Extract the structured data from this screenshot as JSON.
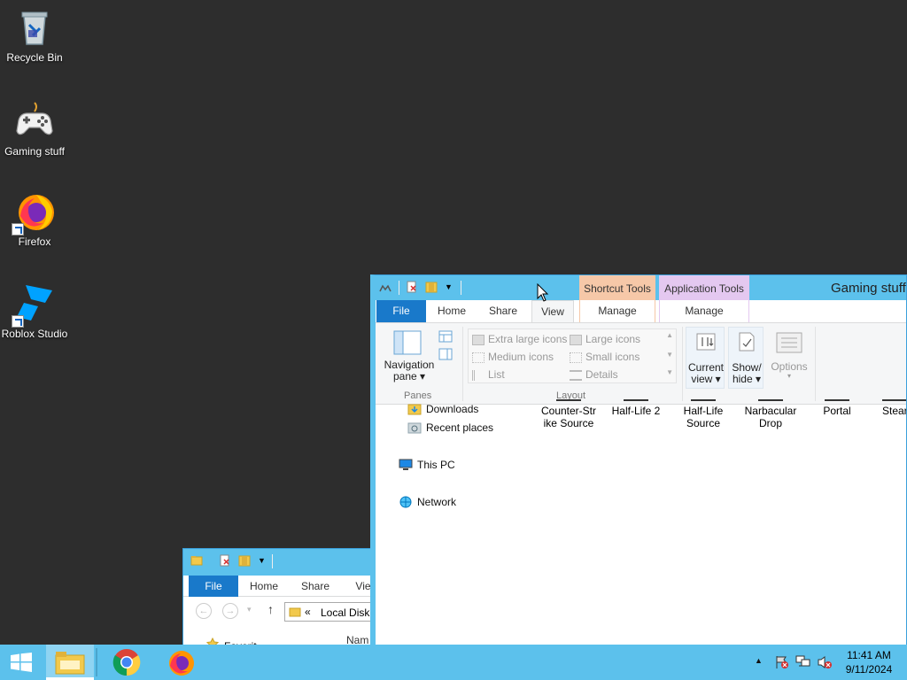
{
  "desktop": {
    "icons": [
      {
        "label": "Recycle Bin",
        "icon": "recycle-bin-icon"
      },
      {
        "label": "Gaming stuff",
        "icon": "gamepad-icon"
      },
      {
        "label": "Firefox",
        "icon": "firefox-icon"
      },
      {
        "label": "Roblox Studio",
        "icon": "roblox-studio-icon"
      }
    ]
  },
  "main_window": {
    "title": "Gaming stuff",
    "contextual_tabs": [
      "Shortcut Tools",
      "Application Tools"
    ],
    "tabs": [
      "File",
      "Home",
      "Share",
      "View",
      "Manage",
      "Manage"
    ],
    "ribbon": {
      "panes_group": {
        "nav_pane_label": "Navigation",
        "nav_pane_label2": "pane ▾",
        "group_label": "Panes"
      },
      "layout_group": {
        "options": [
          "Extra large icons",
          "Large icons",
          "Medium icons",
          "Small icons",
          "List",
          "Details"
        ],
        "group_label": "Layout"
      },
      "current_view": {
        "label1": "Current",
        "label2": "view ▾"
      },
      "show_hide": {
        "label1": "Show/",
        "label2": "hide ▾"
      },
      "options": {
        "label": "Options"
      }
    },
    "nav_tree": [
      "Downloads",
      "Recent places",
      "This PC",
      "Network"
    ],
    "files": [
      {
        "line1": "Counter-Str",
        "line2": "ike Source"
      },
      {
        "line1": "Half-Life 2",
        "line2": ""
      },
      {
        "line1": "Half-Life",
        "line2": "Source"
      },
      {
        "line1": "Narbacular",
        "line2": "Drop"
      },
      {
        "line1": "Portal",
        "line2": ""
      },
      {
        "line1": "Stear",
        "line2": ""
      }
    ]
  },
  "back_window": {
    "tabs": [
      "File",
      "Home",
      "Share",
      "Viev"
    ],
    "address": {
      "prefix": "«",
      "path": "Local Disk"
    },
    "column_header": "Nam",
    "nav_partial": "Favorit"
  },
  "taskbar": {
    "pinned": [
      "start-button",
      "file-explorer",
      "chrome",
      "firefox"
    ],
    "clock_time": "11:41 AM",
    "clock_date": "9/11/2024"
  },
  "colors": {
    "desktop_bg": "#2d2d2d",
    "accent": "#5cc1ec",
    "file_tab": "#1979ca",
    "shortcut_tools_tab": "#f6c8a8",
    "application_tools_tab": "#e4c8f0"
  }
}
